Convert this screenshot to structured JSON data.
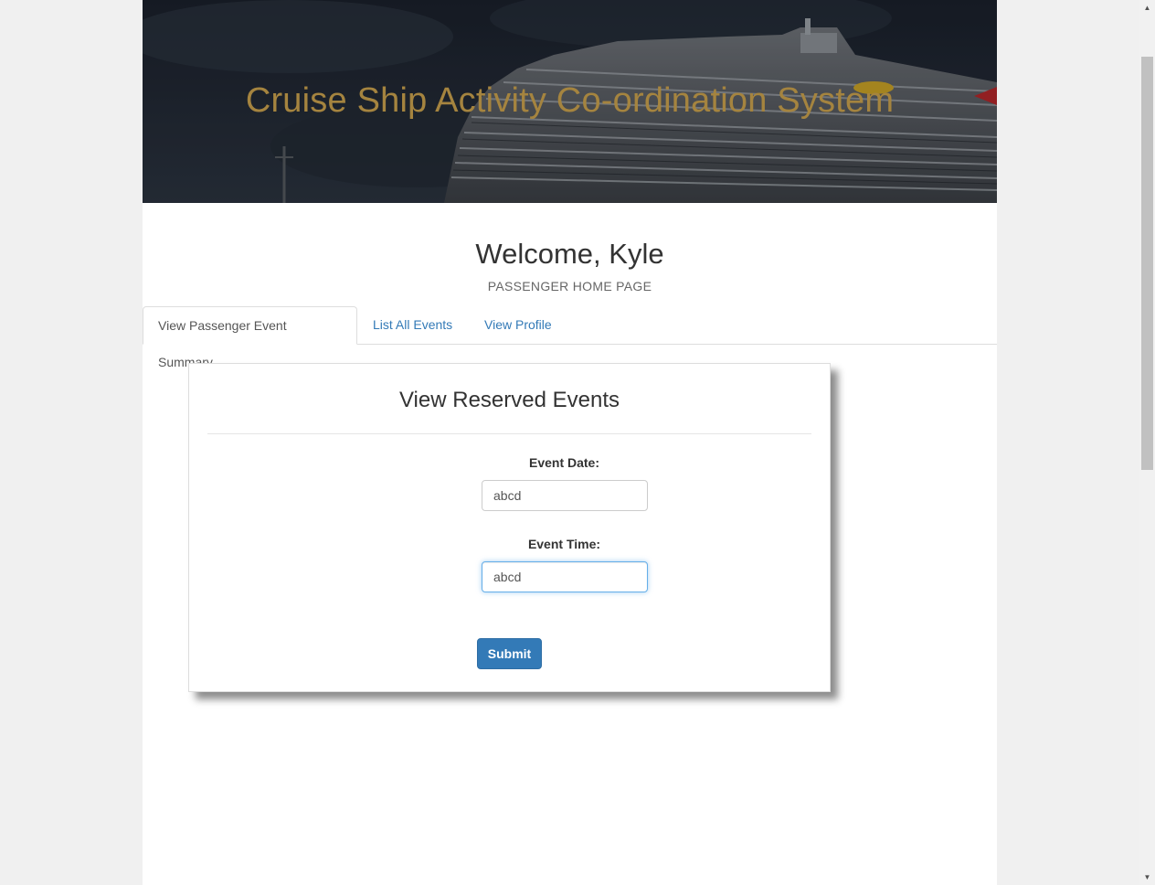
{
  "header": {
    "title": "Cruise Ship Activity Co-ordination System"
  },
  "welcome": {
    "heading": "Welcome, Kyle",
    "subtitle": "PASSENGER HOME PAGE"
  },
  "tabs": [
    {
      "label": "View Passenger Event Summary",
      "active": true
    },
    {
      "label": "List All Events",
      "active": false
    },
    {
      "label": "View Profile",
      "active": false
    }
  ],
  "form": {
    "title": "View Reserved Events",
    "event_date_label": "Event Date:",
    "event_date_value": "abcd",
    "event_time_label": "Event Time:",
    "event_time_value": "abcd",
    "submit_label": "Submit"
  },
  "colors": {
    "title_gold": "#a5843f",
    "primary": "#337ab7",
    "link": "#337ab7"
  }
}
